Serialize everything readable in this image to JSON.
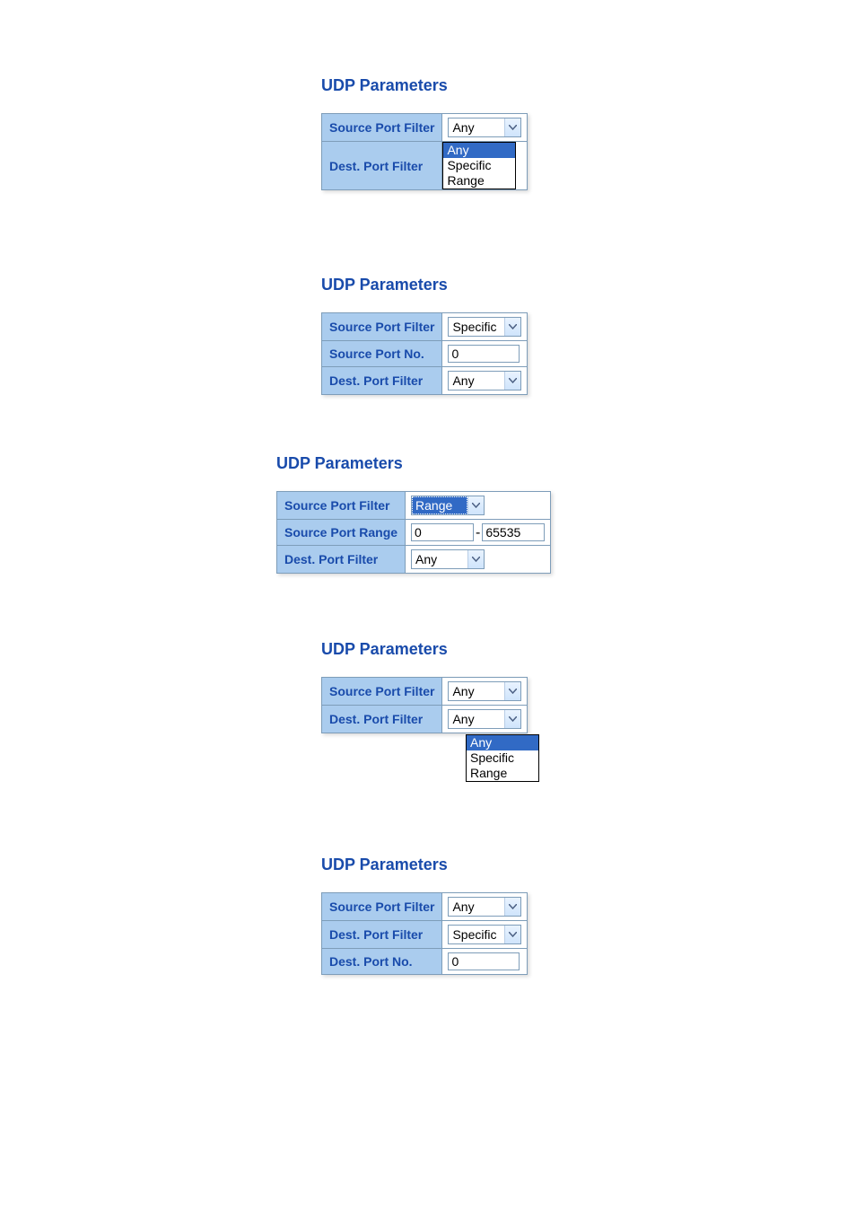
{
  "heading": "UDP Parameters",
  "labels": {
    "source_port_filter": "Source Port Filter",
    "dest_port_filter": "Dest. Port Filter",
    "source_port_no": "Source Port No.",
    "source_port_range": "Source Port Range",
    "dest_port_no": "Dest. Port No."
  },
  "options": {
    "any": "Any",
    "specific": "Specific",
    "range": "Range"
  },
  "panel1": {
    "source_select": "Any",
    "dest_open_highlight": "Any"
  },
  "panel2": {
    "source_select": "Specific",
    "source_port_no": "0",
    "dest_select": "Any"
  },
  "panel3": {
    "source_select": "Range",
    "range_low": "0",
    "range_high": "65535",
    "dest_select": "Any"
  },
  "panel4": {
    "source_select": "Any",
    "dest_select": "Any",
    "dropdown_highlight": "Any"
  },
  "panel5": {
    "source_select": "Any",
    "dest_select": "Specific",
    "dest_port_no": "0"
  },
  "range_dash": "-"
}
